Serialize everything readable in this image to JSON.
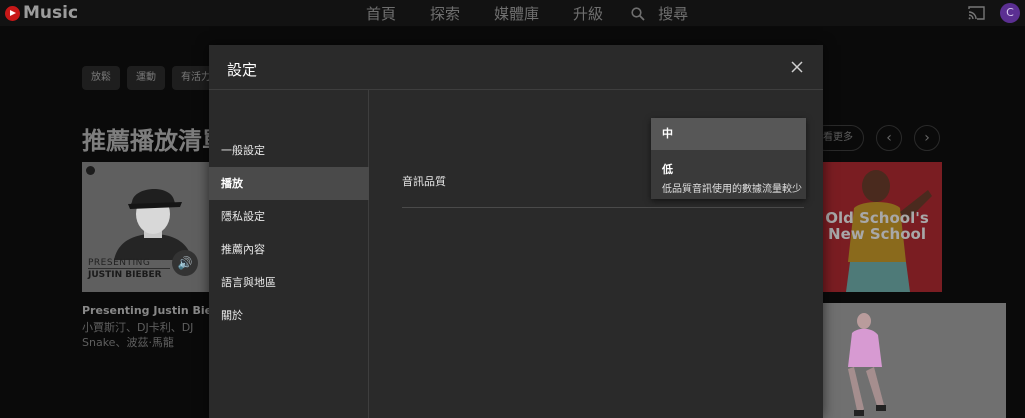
{
  "app": {
    "logo_text": "Music"
  },
  "nav": {
    "items": [
      "首頁",
      "探索",
      "媒體庫",
      "升級"
    ],
    "search_label": "搜尋"
  },
  "avatar_initial": "C",
  "chips": [
    "放鬆",
    "運動",
    "有活力"
  ],
  "section": {
    "title": "推薦播放清單",
    "more_label": "看更多",
    "prev_label": "‹",
    "next_label": "›"
  },
  "cards": {
    "first": {
      "art_line1": "PRESENTING",
      "art_line2": "JUSTIN BIEBER",
      "audio_icon": "🔊",
      "title": "Presenting Justin Bieber",
      "subtitle": "小賈斯汀、DJ卡利、DJ Snake、波茲·馬龍"
    },
    "second": {
      "art_text": "Old School's New School"
    }
  },
  "modal": {
    "title": "設定",
    "nav_items": [
      "一般設定",
      "播放",
      "隱私設定",
      "推薦內容",
      "語言與地區",
      "關於"
    ],
    "active_index": 1,
    "setting_label": "音訊品質",
    "dropdown": {
      "selected": "中",
      "options": [
        {
          "label": "低",
          "description": "低品質音訊使用的數據流量較少"
        }
      ]
    }
  },
  "colors": {
    "modal_bg": "#2a2a2a",
    "active_nav_bg": "#4a4a4a",
    "dropdown_selected_bg": "#575757",
    "logo_red": "#c81818"
  },
  "icons": [
    "youtube-music-logo-icon",
    "search-icon",
    "cast-icon",
    "close-icon",
    "speaker-icon"
  ]
}
